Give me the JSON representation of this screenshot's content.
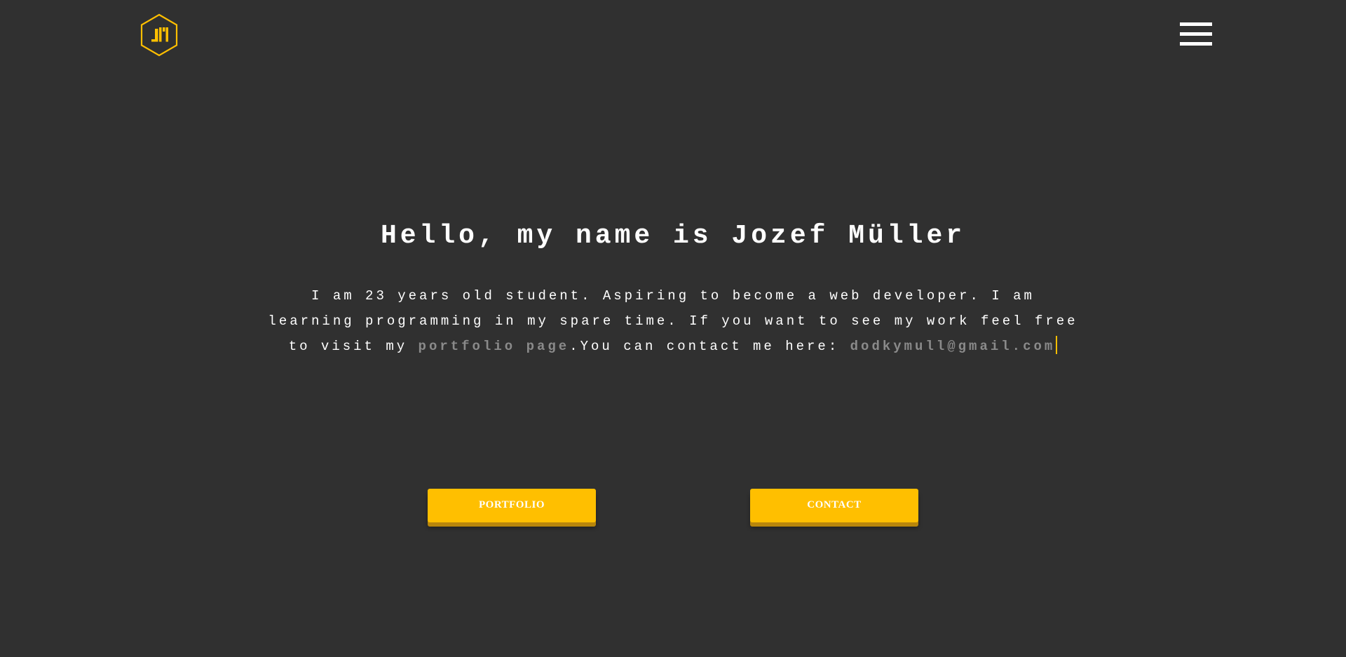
{
  "header": {
    "logo_monogram": "JM",
    "menu_icon": "hamburger-menu-icon"
  },
  "hero": {
    "title": "Hello, my name is Jozef Müller",
    "intro_text": "I am 23 years old student. Aspiring to become a web developer. I am learning programming in my spare time. If you want to see my work feel free to visit my ",
    "portfolio_link_label": "portfolio page",
    "contact_text": ".You can contact me here: ",
    "email": "dodkymull@gmail.com"
  },
  "buttons": {
    "portfolio_label": "PORTFOLIO",
    "contact_label": "CONTACT"
  },
  "colors": {
    "background": "#303030",
    "accent": "#ffbf00",
    "text": "#ffffff",
    "muted_link": "#8a8a8a"
  }
}
